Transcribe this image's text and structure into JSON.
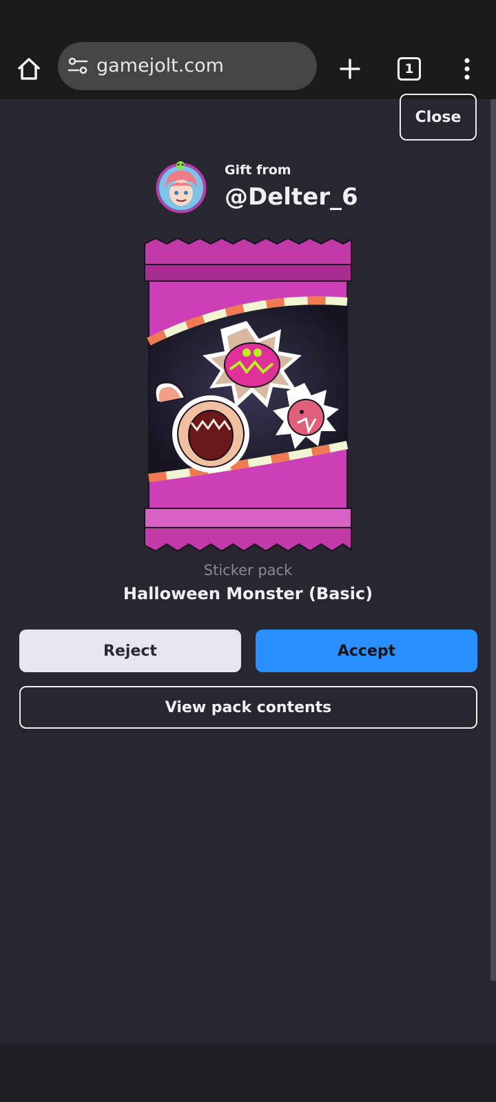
{
  "browser": {
    "url": "gamejolt.com",
    "tab_count": "1",
    "icons": {
      "home": "home-icon",
      "site_settings": "tune-icon",
      "new_tab": "plus-icon",
      "tabs": "tab-switcher-icon",
      "menu": "more-vert-icon"
    }
  },
  "modal": {
    "close_label": "Close",
    "gift_from_label": "Gift from",
    "sender_username": "@Delter_6",
    "pack_type": "Sticker pack",
    "pack_name": "Halloween Monster (Basic)",
    "reject_label": "Reject",
    "accept_label": "Accept",
    "view_contents_label": "View pack contents"
  },
  "colors": {
    "page_bg": "#28262f",
    "chrome_bg": "#1b1b1d",
    "accent": "#2a90ff",
    "pack_magenta": "#c83cb0"
  }
}
